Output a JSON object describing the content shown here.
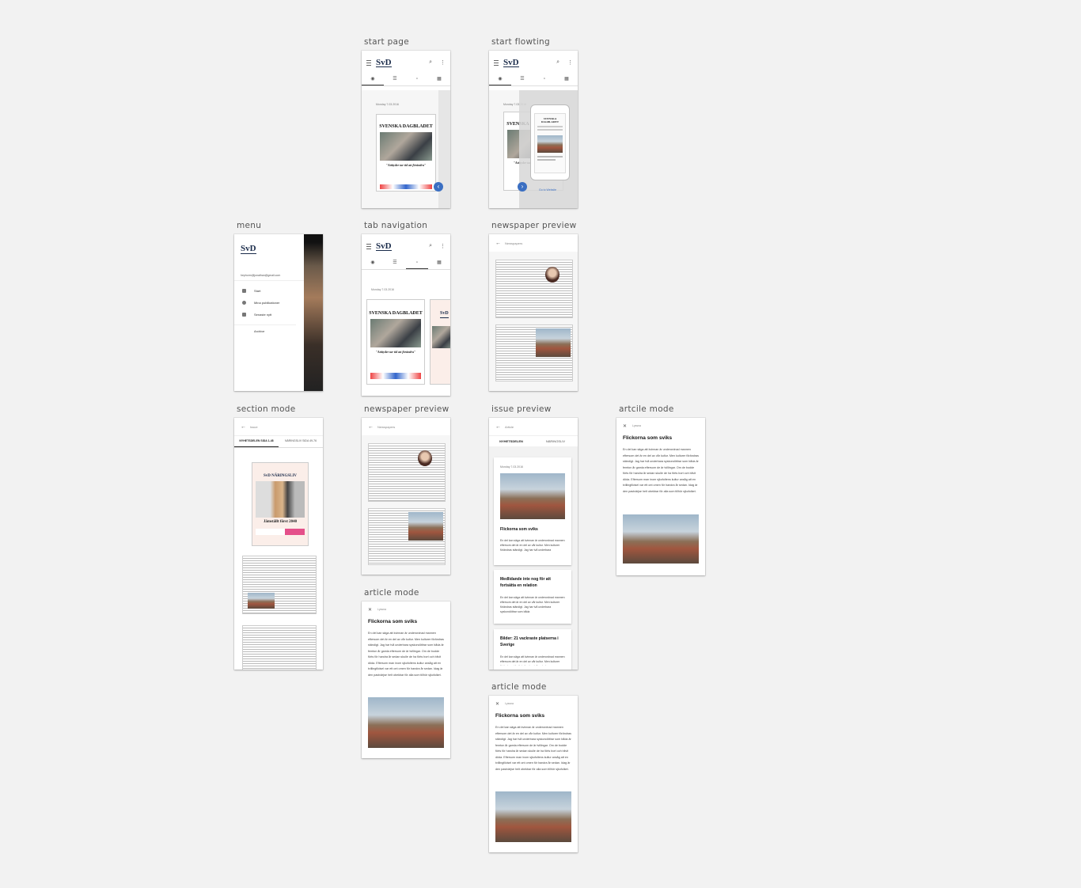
{
  "labels": {
    "start_page": "start page",
    "start_flowting": "start flowting",
    "menu": "menu",
    "tab_navigation": "tab navigation",
    "newspaper_preview_1": "newspaper preview",
    "section_mode": "section mode",
    "newspaper_preview_2": "newspaper preview",
    "issue_preview": "issue preview",
    "artcile_mode": "artcile mode",
    "article_mode_1": "article mode",
    "article_mode_2": "article mode"
  },
  "app": {
    "logo": "SvD",
    "search_icon": "⌕",
    "more_icon": "⋮",
    "date": "Monday 7.03.2016",
    "masthead": "SVENSKA DAGBLADET",
    "headline": "\"Attityder tar tid att förändra\"",
    "go_to_website": "Go to Website",
    "fab_left": "‹",
    "fab_right": "›"
  },
  "menu": {
    "email": "hephorm@jonathan@gmail.com",
    "items": [
      "Start",
      "Mina publikationer",
      "Senaste nytt",
      "Archive"
    ]
  },
  "nav": {
    "back_arrow": "←",
    "newspapers": "Newspapers",
    "issue": "Issue",
    "article": "Article",
    "close": "✕",
    "listen": "Lyssna"
  },
  "section": {
    "tab1": "NYHETSDELEN SIDA 1-48",
    "tab2": "NÄRINGSLIV SIDA 49-76",
    "mast": "SvD NÄRINGSLIV",
    "head": "Jämställt först 2040"
  },
  "issue": {
    "tab1": "NYHETSDELEN",
    "tab2": "NÄRINGSLIV",
    "card1_title": "Flickorna som sviks",
    "card2_title": "Medlidande inte nog för att fortsätta en relation",
    "card3_title": "Bilder: 21 vackraste platserna i Sverige",
    "card_body": "En del kan säga att kvinnan är underordnad mannen eftersom det är en del av vår kultur. Men kulturer förändras ständigt. Jag har två underbara syskondöttrar som båda"
  },
  "article": {
    "title": "Flickorna som sviks",
    "body": "En del kan säga att kvinnan är underordnad mannen eftersom det är en del av vår kultur. Men kulturer förändras ständigt. Jag har två underbara syskondöttrar som båda är femton år gamla eftersom de är tvillingar. Om de bodde förts för handra år sedan skulle de ha förts bort och blivit döda. Eftersom man inom sjkofoltens kultur ansåg att en tvillingfödsel var ett ont omen för handra år sedan. Idag är den pastvärjse helt obekbar för alla som tillhör sjkofolket."
  }
}
